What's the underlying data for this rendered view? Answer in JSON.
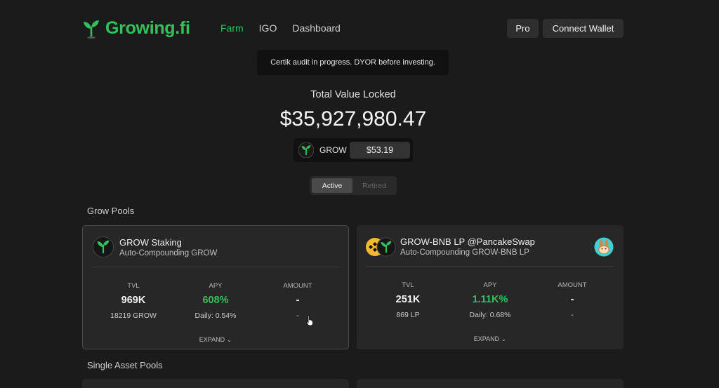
{
  "brand": {
    "name": "Growing.fi",
    "accent": "#2fc35a"
  },
  "nav": {
    "items": [
      "Farm",
      "IGO",
      "Dashboard"
    ],
    "active": "Farm"
  },
  "header": {
    "pro_label": "Pro",
    "connect_label": "Connect Wallet"
  },
  "notice": "Certik audit in progress. DYOR before investing.",
  "tvl": {
    "label": "Total Value Locked",
    "value": "$35,927,980.47"
  },
  "price": {
    "token": "GROW",
    "value": "$53.19"
  },
  "toggle": {
    "active": "Active",
    "retired": "Retired"
  },
  "sections": {
    "grow_pools": "Grow Pools",
    "single_asset": "Single Asset Pools"
  },
  "cards": [
    {
      "title": "GROW Staking",
      "subtitle": "Auto-Compounding GROW",
      "tvl_label": "TVL",
      "tvl": "969K",
      "tvl_sub": "18219 GROW",
      "apy_label": "APY",
      "apy": "608%",
      "apy_sub": "Daily: 0.54%",
      "amount_label": "AMOUNT",
      "amount": "-",
      "amount_sub": "-",
      "expand": "EXPAND ⌄"
    },
    {
      "title": "GROW-BNB LP @PancakeSwap",
      "subtitle": "Auto-Compounding GROW-BNB LP",
      "tvl_label": "TVL",
      "tvl": "251K",
      "tvl_sub": "869 LP",
      "apy_label": "APY",
      "apy": "1.11K%",
      "apy_sub": "Daily: 0.68%",
      "amount_label": "AMOUNT",
      "amount": "-",
      "amount_sub": "-",
      "expand": "EXPAND ⌄"
    }
  ],
  "icons": [
    "grow-sprout-icon",
    "bnb-icon",
    "pancakeswap-bunny-icon",
    "cursor-pointer-icon"
  ]
}
